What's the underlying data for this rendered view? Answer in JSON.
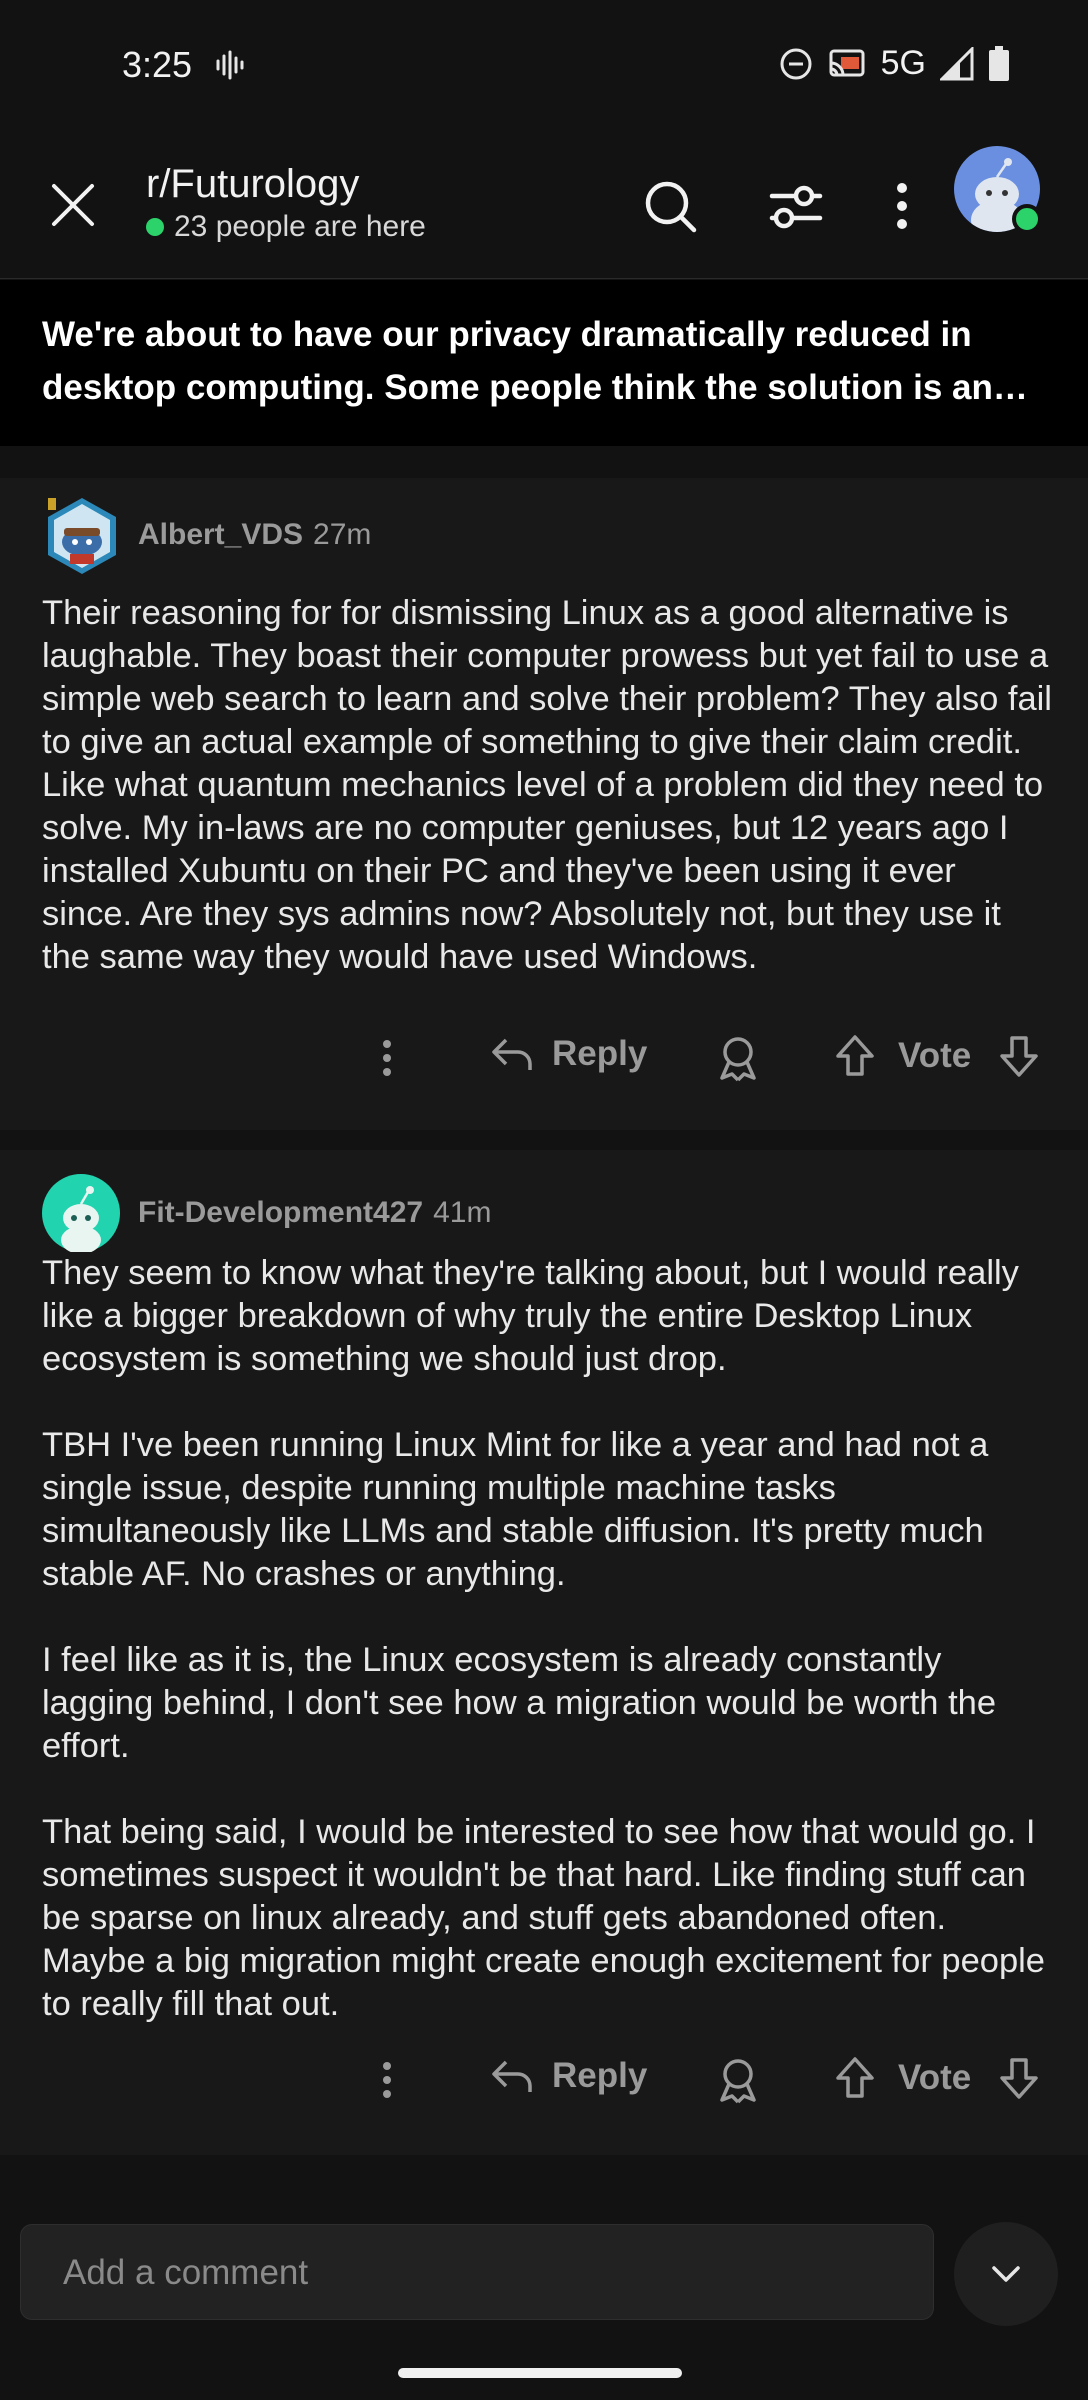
{
  "status_bar": {
    "time": "3:25",
    "network": "5G"
  },
  "header": {
    "subreddit": "r/Futurology",
    "online_text": "23 people are here"
  },
  "post": {
    "title": "We're about to have our privacy dramatically reduced in desktop computing. Some people think the solution is an op..."
  },
  "comments": [
    {
      "username": "Albert_VDS",
      "time": "27m",
      "body": "Their reasoning for for dismissing Linux as a good alternative is laughable. They boast their computer prowess but yet fail to use a simple web search to learn and solve their problem? They also fail to give an actual example of something to give their claim credit. Like what quantum mechanics level of a problem did they need to solve. My in-laws are no computer geniuses, but 12 years ago I installed Xubuntu on their PC and they've been using it ever since. Are they sys admins now? Absolutely not, but they use it the same way they would have used Windows.",
      "reply_label": "Reply",
      "vote_label": "Vote"
    },
    {
      "username": "Fit-Development427",
      "time": "41m",
      "body": "They seem to know what they're talking about, but I would really like a bigger breakdown of why truly the entire Desktop Linux ecosystem is something we should just drop.\n\nTBH I've been running Linux Mint for like a year and had not a single issue, despite running multiple machine tasks simultaneously like LLMs and stable diffusion. It's pretty much stable AF. No crashes or anything.\n\nI feel like as it is, the Linux ecosystem is already constantly lagging behind, I don't see how a migration would be worth the effort.\n\nThat being said, I would be interested to see how that would go. I sometimes suspect it wouldn't be that hard. Like finding stuff can be sparse on linux already, and stuff gets abandoned often. Maybe a big migration might create enough excitement for people to really fill that out.",
      "reply_label": "Reply",
      "vote_label": "Vote"
    }
  ],
  "comment_box": {
    "placeholder": "Add a comment"
  },
  "colors": {
    "online": "#2bd36a",
    "background": "#121212",
    "card": "#181818",
    "muted": "#9a9a9a"
  },
  "icons": [
    "close-icon",
    "search-icon",
    "filter-icon",
    "more-vertical-icon",
    "reply-icon",
    "award-icon",
    "upvote-icon",
    "downvote-icon",
    "chevron-down-icon"
  ]
}
